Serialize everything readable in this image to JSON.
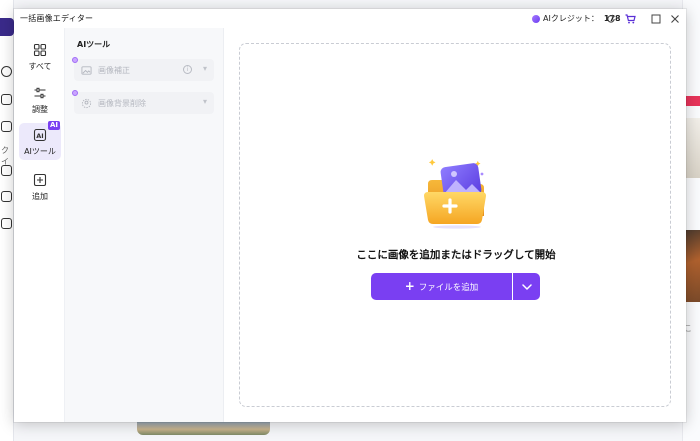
{
  "window": {
    "title": "一括画像エディター",
    "credits_label": "AIクレジット：",
    "credits_value": "178"
  },
  "nav": {
    "items": [
      {
        "id": "all",
        "label": "すべて",
        "active": false
      },
      {
        "id": "adjust",
        "label": "調整",
        "active": false
      },
      {
        "id": "ai",
        "label": "AIツール",
        "active": true,
        "badge": "AI"
      },
      {
        "id": "add",
        "label": "追加",
        "active": false
      }
    ]
  },
  "tools_panel": {
    "title": "AIツール",
    "tools": [
      {
        "label": "画像補正",
        "info": "i"
      },
      {
        "label": "画像背景削除"
      }
    ]
  },
  "main": {
    "drop_text": "ここに画像を追加またはドラッグして開始",
    "add_button_label": "ファイルを追加",
    "add_button_icon": "+"
  },
  "background": {
    "rail_label": "クイ",
    "side_label": "こ"
  },
  "colors": {
    "accent": "#7a3ff2",
    "active_nav_bg": "#ece9fb"
  }
}
